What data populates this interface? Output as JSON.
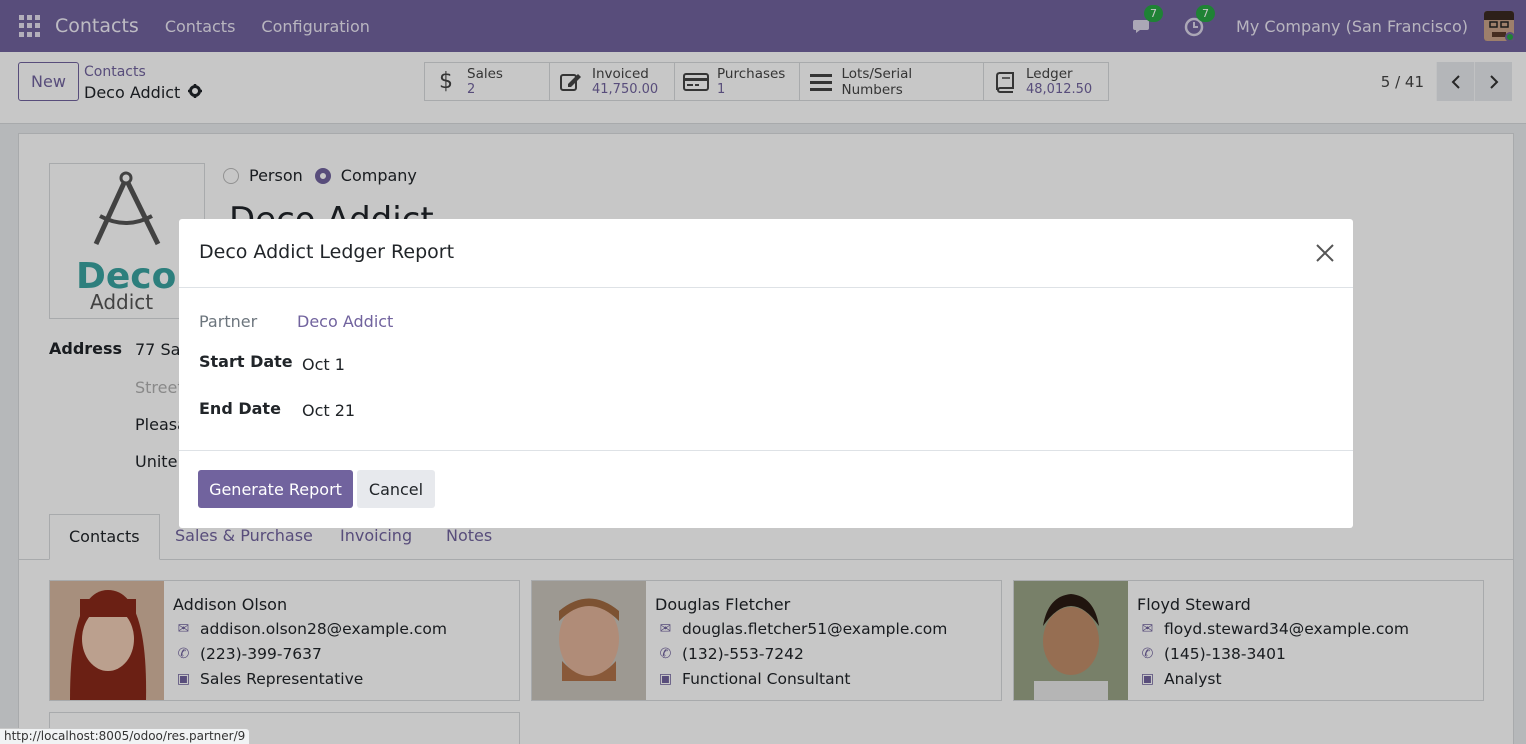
{
  "navbar": {
    "app_name": "Contacts",
    "menu": [
      "Contacts",
      "Configuration"
    ],
    "messages_count": "7",
    "activities_count": "7",
    "company": "My Company (San Francisco)"
  },
  "control_panel": {
    "new_label": "New",
    "breadcrumb_parent": "Contacts",
    "breadcrumb_current": "Deco Addict",
    "stats": [
      {
        "icon": "dollar-icon",
        "label": "Sales",
        "value": "2"
      },
      {
        "icon": "invoice-edit-icon",
        "label": "Invoiced",
        "value": "41,750.00"
      },
      {
        "icon": "credit-card-icon",
        "label": "Purchases",
        "value": "1"
      },
      {
        "icon": "list-icon",
        "label": "Lots/Serial Numbers",
        "value": ""
      },
      {
        "icon": "book-icon",
        "label": "Ledger",
        "value": "48,012.50"
      }
    ],
    "pager": "5 / 41"
  },
  "form": {
    "logo_line1": "Deco",
    "logo_line2": "Addict",
    "type_options": [
      "Person",
      "Company"
    ],
    "selected_type": "Company",
    "name": "Deco Addict",
    "address_label": "Address",
    "address_lines": [
      "77 San",
      "Street",
      "Pleasa",
      "Unite"
    ],
    "tabs": [
      "Contacts",
      "Sales & Purchase",
      "Invoicing",
      "Notes"
    ],
    "contacts": [
      {
        "name": "Addison Olson",
        "email": "addison.olson28@example.com",
        "phone": "(223)-399-7637",
        "job": "Sales Representative"
      },
      {
        "name": "Douglas Fletcher",
        "email": "douglas.fletcher51@example.com",
        "phone": "(132)-553-7242",
        "job": "Functional Consultant"
      },
      {
        "name": "Floyd Steward",
        "email": "floyd.steward34@example.com",
        "phone": "(145)-138-3401",
        "job": "Analyst"
      }
    ]
  },
  "modal": {
    "title": "Deco Addict Ledger Report",
    "partner_label": "Partner",
    "partner_value": "Deco Addict",
    "start_label": "Start Date",
    "start_value": "Oct 1",
    "end_label": "End Date",
    "end_value": "Oct 21",
    "generate_label": "Generate Report",
    "cancel_label": "Cancel"
  },
  "status_url": "http://localhost:8005/odoo/res.partner/9",
  "colors": {
    "brand": "#71639e",
    "badge": "#28a745",
    "logo_teal": "#3aa3a0"
  }
}
